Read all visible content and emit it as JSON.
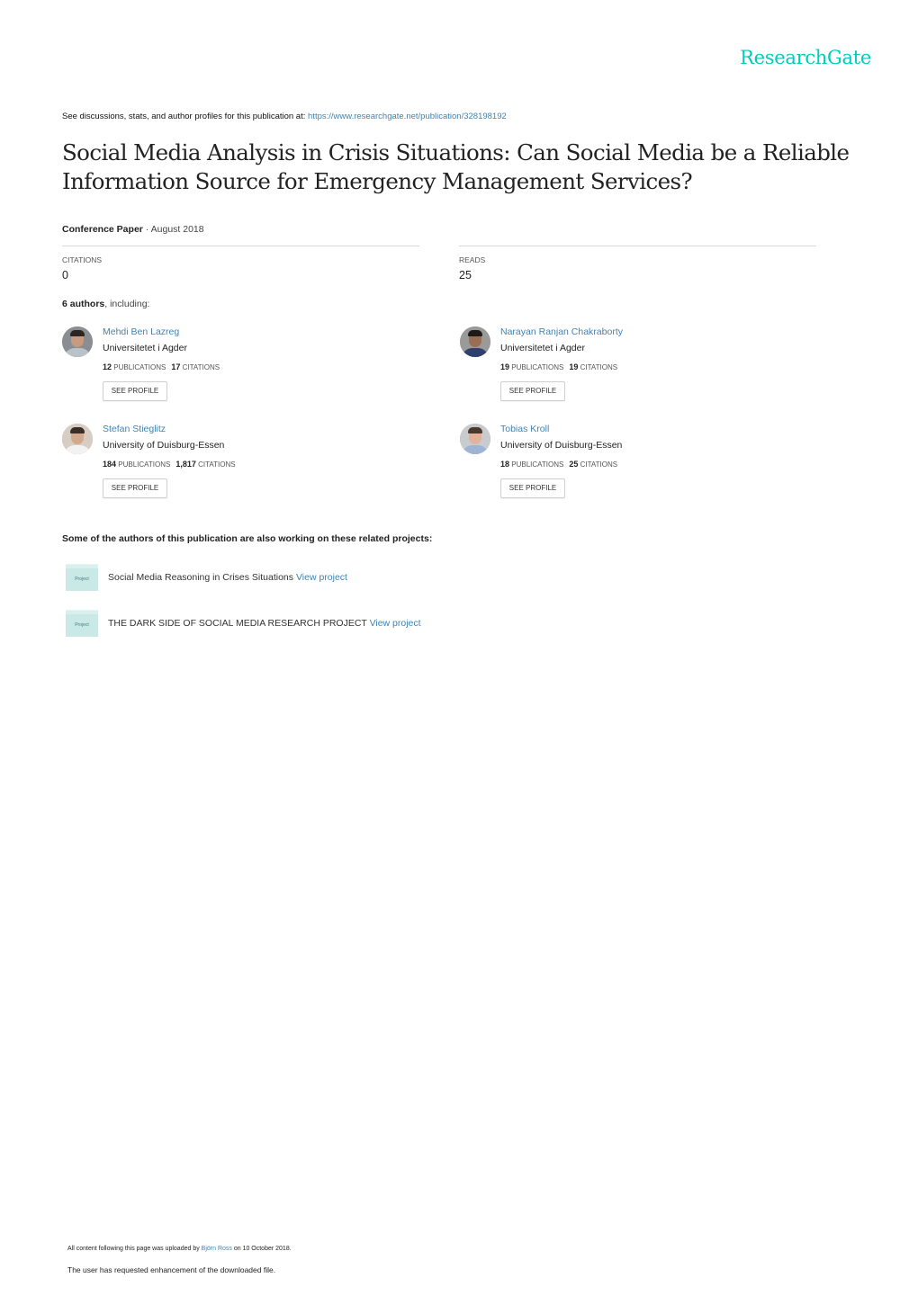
{
  "brand": {
    "logo_text": "ResearchGate",
    "accent_color": "#00ccbb",
    "link_color": "#3e84b3"
  },
  "header": {
    "see_line_prefix": "See discussions, stats, and author profiles for this publication at: ",
    "publication_url": "https://www.researchgate.net/publication/328198192"
  },
  "publication": {
    "title": "Social Media Analysis in Crisis Situations: Can Social Media be a Reliable Information Source for Emergency Management Services?",
    "type": "Conference Paper",
    "date_sep": " · ",
    "date": "August 2018"
  },
  "stats": {
    "citations_label": "CITATIONS",
    "citations_value": "0",
    "reads_label": "READS",
    "reads_value": "25"
  },
  "authors_summary": {
    "count_text": "6 authors",
    "suffix": ", including:"
  },
  "authors": [
    {
      "name": "Mehdi Ben Lazreg",
      "institution": "Universitetet i Agder",
      "publications": "12",
      "publications_label": "PUBLICATIONS",
      "citations": "17",
      "citations_label": "CITATIONS",
      "button": "SEE PROFILE"
    },
    {
      "name": "Narayan Ranjan Chakraborty",
      "institution": "Universitetet i Agder",
      "publications": "19",
      "publications_label": "PUBLICATIONS",
      "citations": "19",
      "citations_label": "CITATIONS",
      "button": "SEE PROFILE"
    },
    {
      "name": "Stefan Stieglitz",
      "institution": "University of Duisburg-Essen",
      "publications": "184",
      "publications_label": "PUBLICATIONS",
      "citations": "1,817",
      "citations_label": "CITATIONS",
      "button": "SEE PROFILE"
    },
    {
      "name": "Tobias Kroll",
      "institution": "University of Duisburg-Essen",
      "publications": "18",
      "publications_label": "PUBLICATIONS",
      "citations": "25",
      "citations_label": "CITATIONS",
      "button": "SEE PROFILE"
    }
  ],
  "projects": {
    "heading": "Some of the authors of this publication are also working on these related projects:",
    "icon_label": "Project",
    "items": [
      {
        "title": "Social Media Reasoning in Crises Situations",
        "link": "View project"
      },
      {
        "title": "THE DARK SIDE OF SOCIAL MEDIA RESEARCH PROJECT",
        "link": "View project"
      }
    ]
  },
  "footer": {
    "uploaded_prefix": "All content following this page was uploaded by ",
    "uploader": "Björn Ross",
    "uploaded_suffix": " on 10 October 2018.",
    "enhancement_note": "The user has requested enhancement of the downloaded file."
  }
}
